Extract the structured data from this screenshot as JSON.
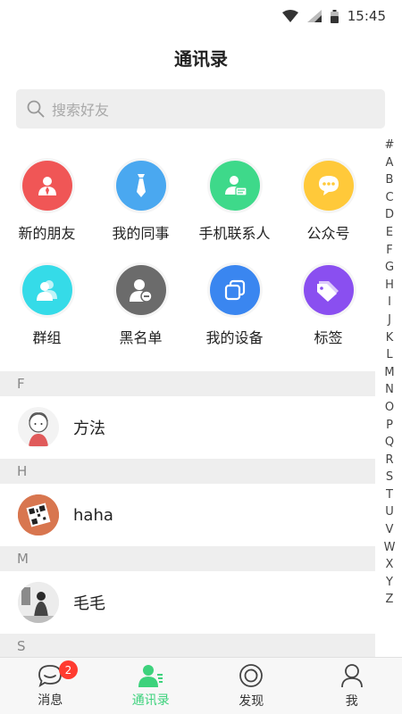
{
  "status_bar": {
    "time": "15:45"
  },
  "header": {
    "title": "通讯录"
  },
  "search": {
    "placeholder": "搜索好友"
  },
  "shortcuts": [
    {
      "label": "新的朋友",
      "icon": "new-friend-icon",
      "color": "#f05656"
    },
    {
      "label": "我的同事",
      "icon": "colleague-tie-icon",
      "color": "#4aa8f0"
    },
    {
      "label": "手机联系人",
      "icon": "phone-contact-icon",
      "color": "#3ed98a"
    },
    {
      "label": "公众号",
      "icon": "official-account-chat-icon",
      "color": "#ffc93a"
    },
    {
      "label": "群组",
      "icon": "group-icon",
      "color": "#35dbe8"
    },
    {
      "label": "黑名单",
      "icon": "blacklist-icon",
      "color": "#6b6b6b"
    },
    {
      "label": "我的设备",
      "icon": "device-icon",
      "color": "#3a86f0"
    },
    {
      "label": "标签",
      "icon": "tag-icon",
      "color": "#8a4ff0"
    }
  ],
  "alpha_index": [
    "#",
    "A",
    "B",
    "C",
    "D",
    "E",
    "F",
    "G",
    "H",
    "I",
    "J",
    "K",
    "L",
    "M",
    "N",
    "O",
    "P",
    "Q",
    "R",
    "S",
    "T",
    "U",
    "V",
    "W",
    "X",
    "Y",
    "Z"
  ],
  "contacts": [
    {
      "section": "F",
      "name": "方法"
    },
    {
      "section": "H",
      "name": "haha"
    },
    {
      "section": "M",
      "name": "毛毛"
    },
    {
      "section": "S",
      "name": ""
    }
  ],
  "tabbar": {
    "tabs": [
      {
        "label": "消息",
        "badge": "2"
      },
      {
        "label": "通讯录"
      },
      {
        "label": "发现"
      },
      {
        "label": "我"
      }
    ],
    "active_color": "#3dd27c"
  }
}
